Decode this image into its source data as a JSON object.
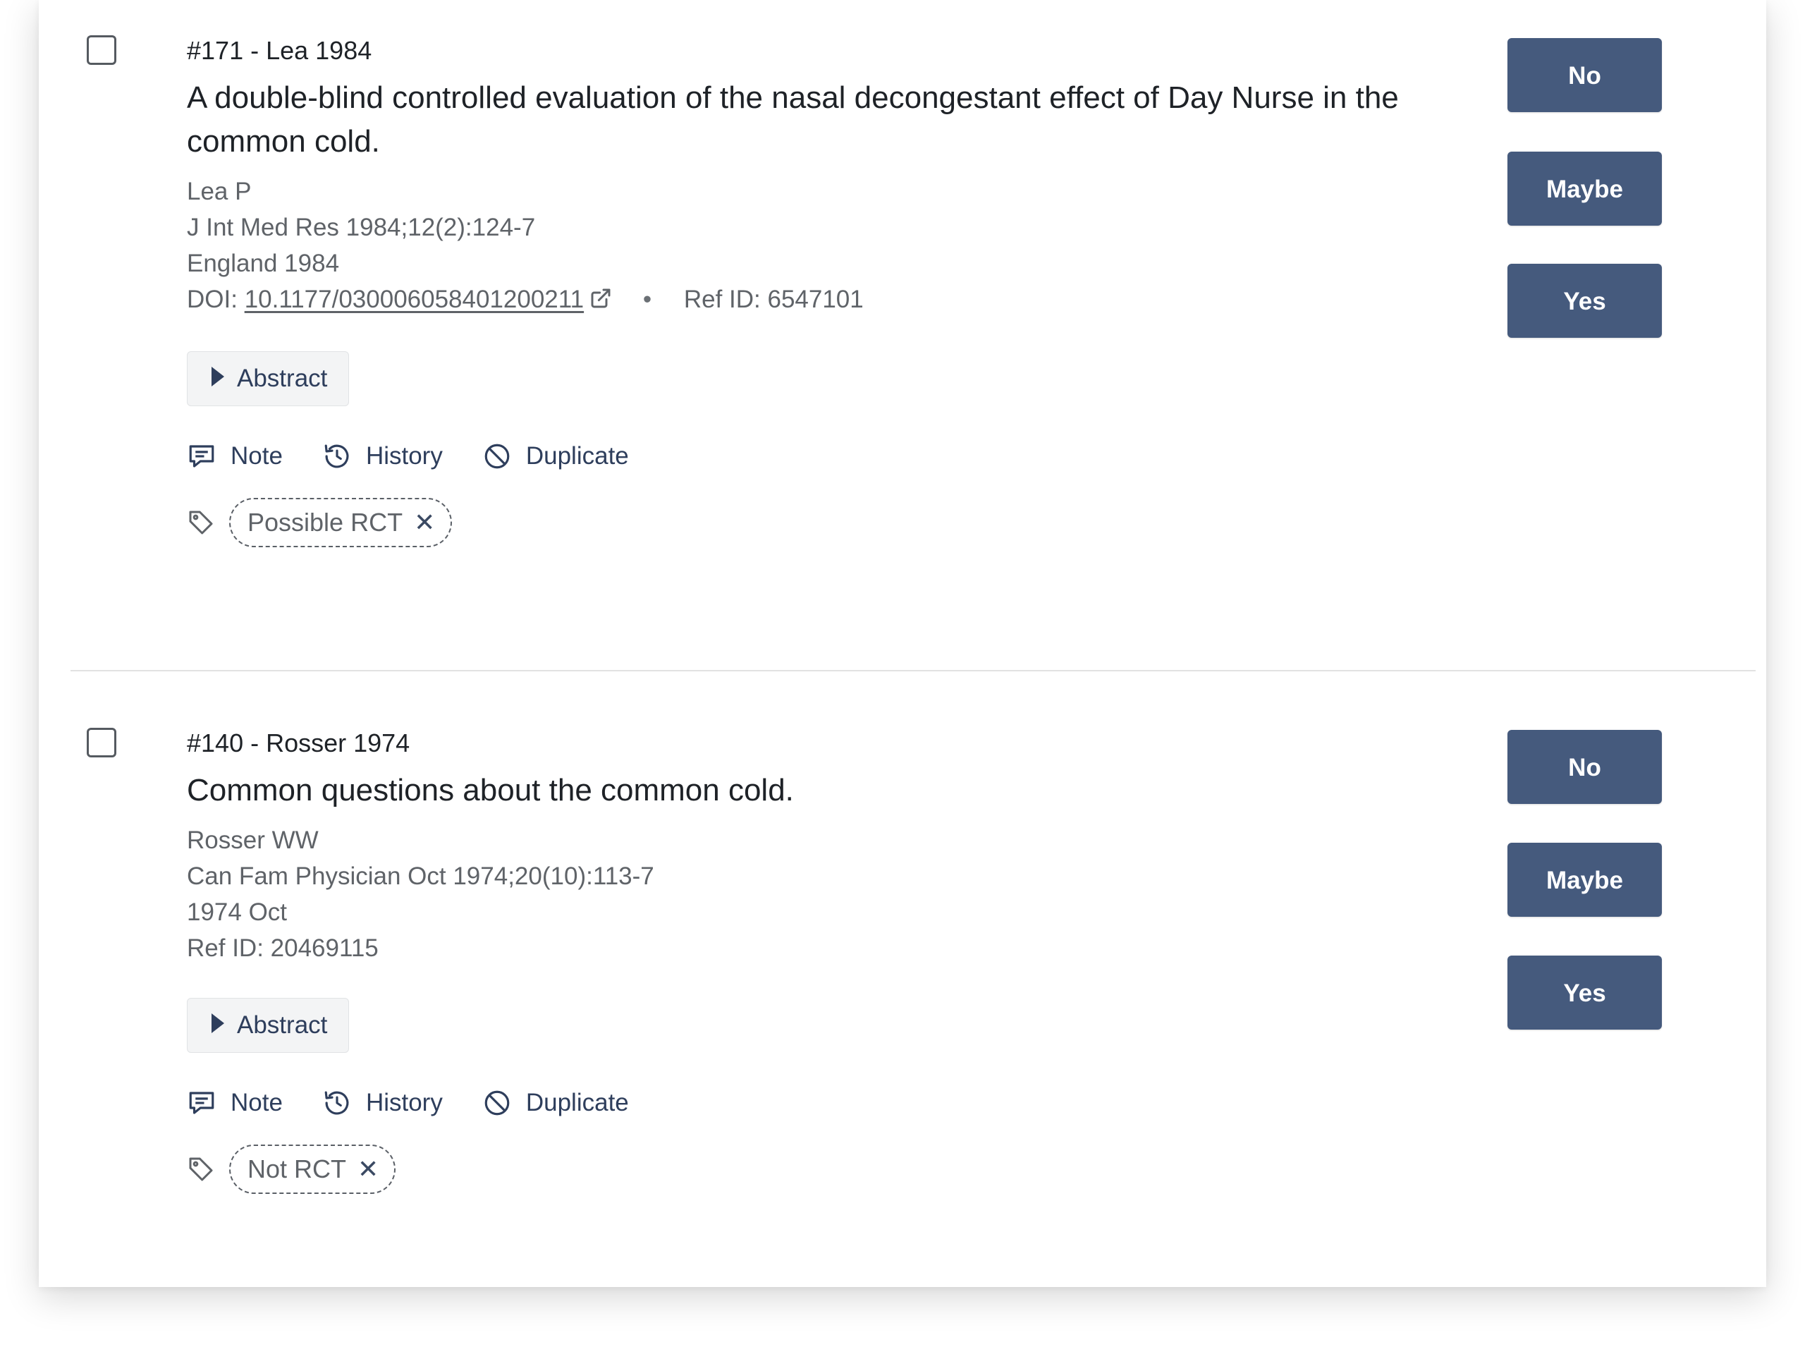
{
  "records": [
    {
      "ident": "#171 - Lea 1984",
      "title": "A double-blind controlled evaluation of the nasal decongestant effect of Day Nurse in the common cold.",
      "authors": "Lea P",
      "journal": "J Int Med Res 1984;12(2):124-7",
      "location_date": "England 1984",
      "doi_label": "DOI:",
      "doi": "10.1177/030006058401200211",
      "separator": "•",
      "ref_id": "Ref ID: 6547101",
      "abstract_label": "Abstract",
      "actions": {
        "note": "Note",
        "history": "History",
        "duplicate": "Duplicate"
      },
      "tag": "Possible RCT",
      "tag_remove": "✕",
      "buttons": {
        "no": "No",
        "maybe": "Maybe",
        "yes": "Yes"
      }
    },
    {
      "ident": "#140 - Rosser 1974",
      "title": "Common questions about the common cold.",
      "authors": "Rosser WW",
      "journal": "Can Fam Physician Oct 1974;20(10):113-7",
      "location_date": "1974 Oct",
      "ref_id": "Ref ID: 20469115",
      "abstract_label": "Abstract",
      "actions": {
        "note": "Note",
        "history": "History",
        "duplicate": "Duplicate"
      },
      "tag": "Not RCT",
      "tag_remove": "✕",
      "buttons": {
        "no": "No",
        "maybe": "Maybe",
        "yes": "Yes"
      }
    }
  ],
  "colors": {
    "button_bg": "#455a7d",
    "link_text": "#2e3e5c",
    "meta_text": "#5f6368",
    "title_text": "#1e2227"
  },
  "icons": [
    "external-link-icon",
    "note-icon",
    "history-icon",
    "duplicate-icon",
    "tag-icon",
    "caret-right-icon",
    "close-icon"
  ]
}
